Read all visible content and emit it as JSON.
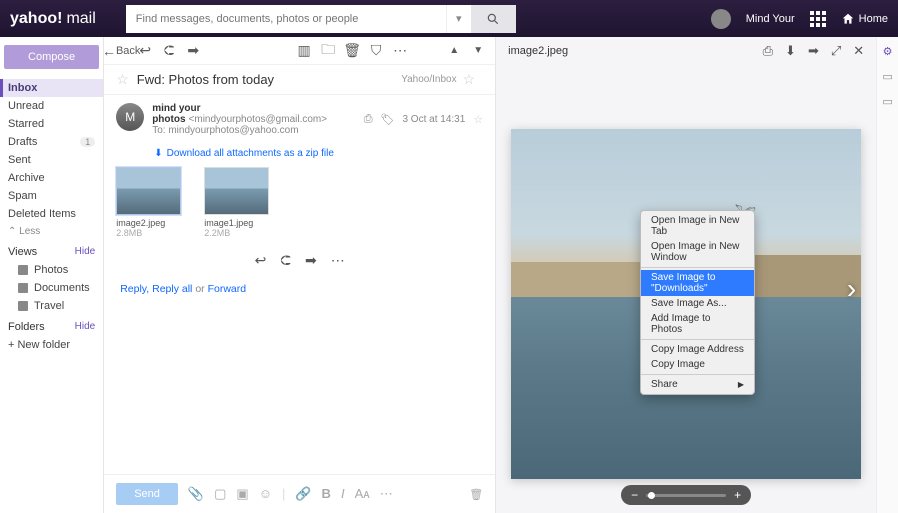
{
  "brand": {
    "name": "yahoo!",
    "sub": "mail"
  },
  "search": {
    "placeholder": "Find messages, documents, photos or people"
  },
  "user": {
    "name": "Mind Your",
    "home": "Home"
  },
  "sidebar": {
    "compose": "Compose",
    "folders": [
      "Inbox",
      "Unread",
      "Starred",
      "Drafts",
      "Sent",
      "Archive",
      "Spam",
      "Deleted Items"
    ],
    "drafts_badge": "1",
    "less": "Less",
    "views_hdr": "Views",
    "hide": "Hide",
    "views": [
      "Photos",
      "Documents",
      "Travel"
    ],
    "folders_hdr": "Folders",
    "new_folder": "+  New folder"
  },
  "toolbar": {
    "back": "Back"
  },
  "message": {
    "subject": "Fwd: Photos from today",
    "location": "Yahoo/Inbox",
    "sender_name": "mind your photos",
    "sender_email": "<mindyourphotos@gmail.com>",
    "to_label": "To:",
    "to_value": "mindyourphotos@yahoo.com",
    "time": "3 Oct at 14:31",
    "download_all": "Download all attachments as a zip file",
    "attachments": [
      {
        "name": "image2.jpeg",
        "size": "2.8MB"
      },
      {
        "name": "image1.jpeg",
        "size": "2.2MB"
      }
    ],
    "reply_text": "Reply",
    "reply_all_text": "Reply all",
    "or": " or ",
    "forward_text": "Forward",
    "send": "Send"
  },
  "preview": {
    "filename": "image2.jpeg"
  },
  "context_menu": {
    "items": [
      "Open Image in New Tab",
      "Open Image in New Window",
      "Save Image to \"Downloads\"",
      "Save Image As...",
      "Add Image to Photos",
      "Copy Image Address",
      "Copy Image",
      "Share"
    ]
  }
}
